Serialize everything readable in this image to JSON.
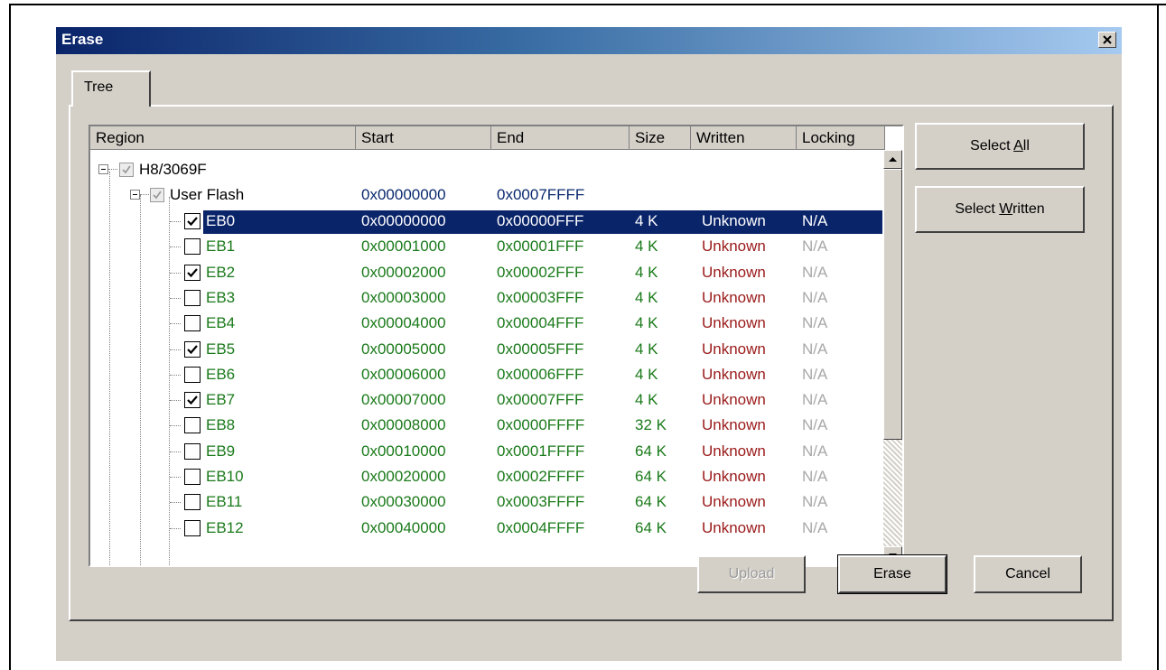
{
  "dialog": {
    "title": "Erase"
  },
  "tabs": [
    {
      "label": "Tree"
    }
  ],
  "columns": [
    "Region",
    "Start",
    "End",
    "Size",
    "Written",
    "Locking"
  ],
  "tree": {
    "device": {
      "label": "H8/3069F",
      "checked": true
    },
    "area": {
      "label": "User Flash",
      "start": "0x00000000",
      "end": "0x0007FFFF",
      "checked": true
    },
    "blocks": [
      {
        "name": "EB0",
        "start": "0x00000000",
        "end": "0x00000FFF",
        "size": "4 K",
        "written": "Unknown",
        "locking": "N/A",
        "checked": true,
        "selected": true
      },
      {
        "name": "EB1",
        "start": "0x00001000",
        "end": "0x00001FFF",
        "size": "4 K",
        "written": "Unknown",
        "locking": "N/A",
        "checked": false
      },
      {
        "name": "EB2",
        "start": "0x00002000",
        "end": "0x00002FFF",
        "size": "4 K",
        "written": "Unknown",
        "locking": "N/A",
        "checked": true
      },
      {
        "name": "EB3",
        "start": "0x00003000",
        "end": "0x00003FFF",
        "size": "4 K",
        "written": "Unknown",
        "locking": "N/A",
        "checked": false
      },
      {
        "name": "EB4",
        "start": "0x00004000",
        "end": "0x00004FFF",
        "size": "4 K",
        "written": "Unknown",
        "locking": "N/A",
        "checked": false
      },
      {
        "name": "EB5",
        "start": "0x00005000",
        "end": "0x00005FFF",
        "size": "4 K",
        "written": "Unknown",
        "locking": "N/A",
        "checked": true
      },
      {
        "name": "EB6",
        "start": "0x00006000",
        "end": "0x00006FFF",
        "size": "4 K",
        "written": "Unknown",
        "locking": "N/A",
        "checked": false
      },
      {
        "name": "EB7",
        "start": "0x00007000",
        "end": "0x00007FFF",
        "size": "4 K",
        "written": "Unknown",
        "locking": "N/A",
        "checked": true
      },
      {
        "name": "EB8",
        "start": "0x00008000",
        "end": "0x0000FFFF",
        "size": "32 K",
        "written": "Unknown",
        "locking": "N/A",
        "checked": false
      },
      {
        "name": "EB9",
        "start": "0x00010000",
        "end": "0x0001FFFF",
        "size": "64 K",
        "written": "Unknown",
        "locking": "N/A",
        "checked": false
      },
      {
        "name": "EB10",
        "start": "0x00020000",
        "end": "0x0002FFFF",
        "size": "64 K",
        "written": "Unknown",
        "locking": "N/A",
        "checked": false
      },
      {
        "name": "EB11",
        "start": "0x00030000",
        "end": "0x0003FFFF",
        "size": "64 K",
        "written": "Unknown",
        "locking": "N/A",
        "checked": false
      },
      {
        "name": "EB12",
        "start": "0x00040000",
        "end": "0x0004FFFF",
        "size": "64 K",
        "written": "Unknown",
        "locking": "N/A",
        "checked": false
      }
    ]
  },
  "side_buttons": {
    "select_all": {
      "pre": "Select ",
      "mnemonic": "A",
      "post": "ll"
    },
    "select_written": {
      "pre": "Select ",
      "mnemonic": "W",
      "post": "ritten"
    }
  },
  "footer_buttons": {
    "upload": "Upload",
    "erase": "Erase",
    "cancel": "Cancel"
  },
  "colors": {
    "title_start": "#0a246a",
    "title_end": "#a6caf0",
    "selection": "#0a246a",
    "unchecked_text": "#1a7a1a",
    "checked_text": "#1a7a1a",
    "written_text": "#9a1a1a"
  }
}
